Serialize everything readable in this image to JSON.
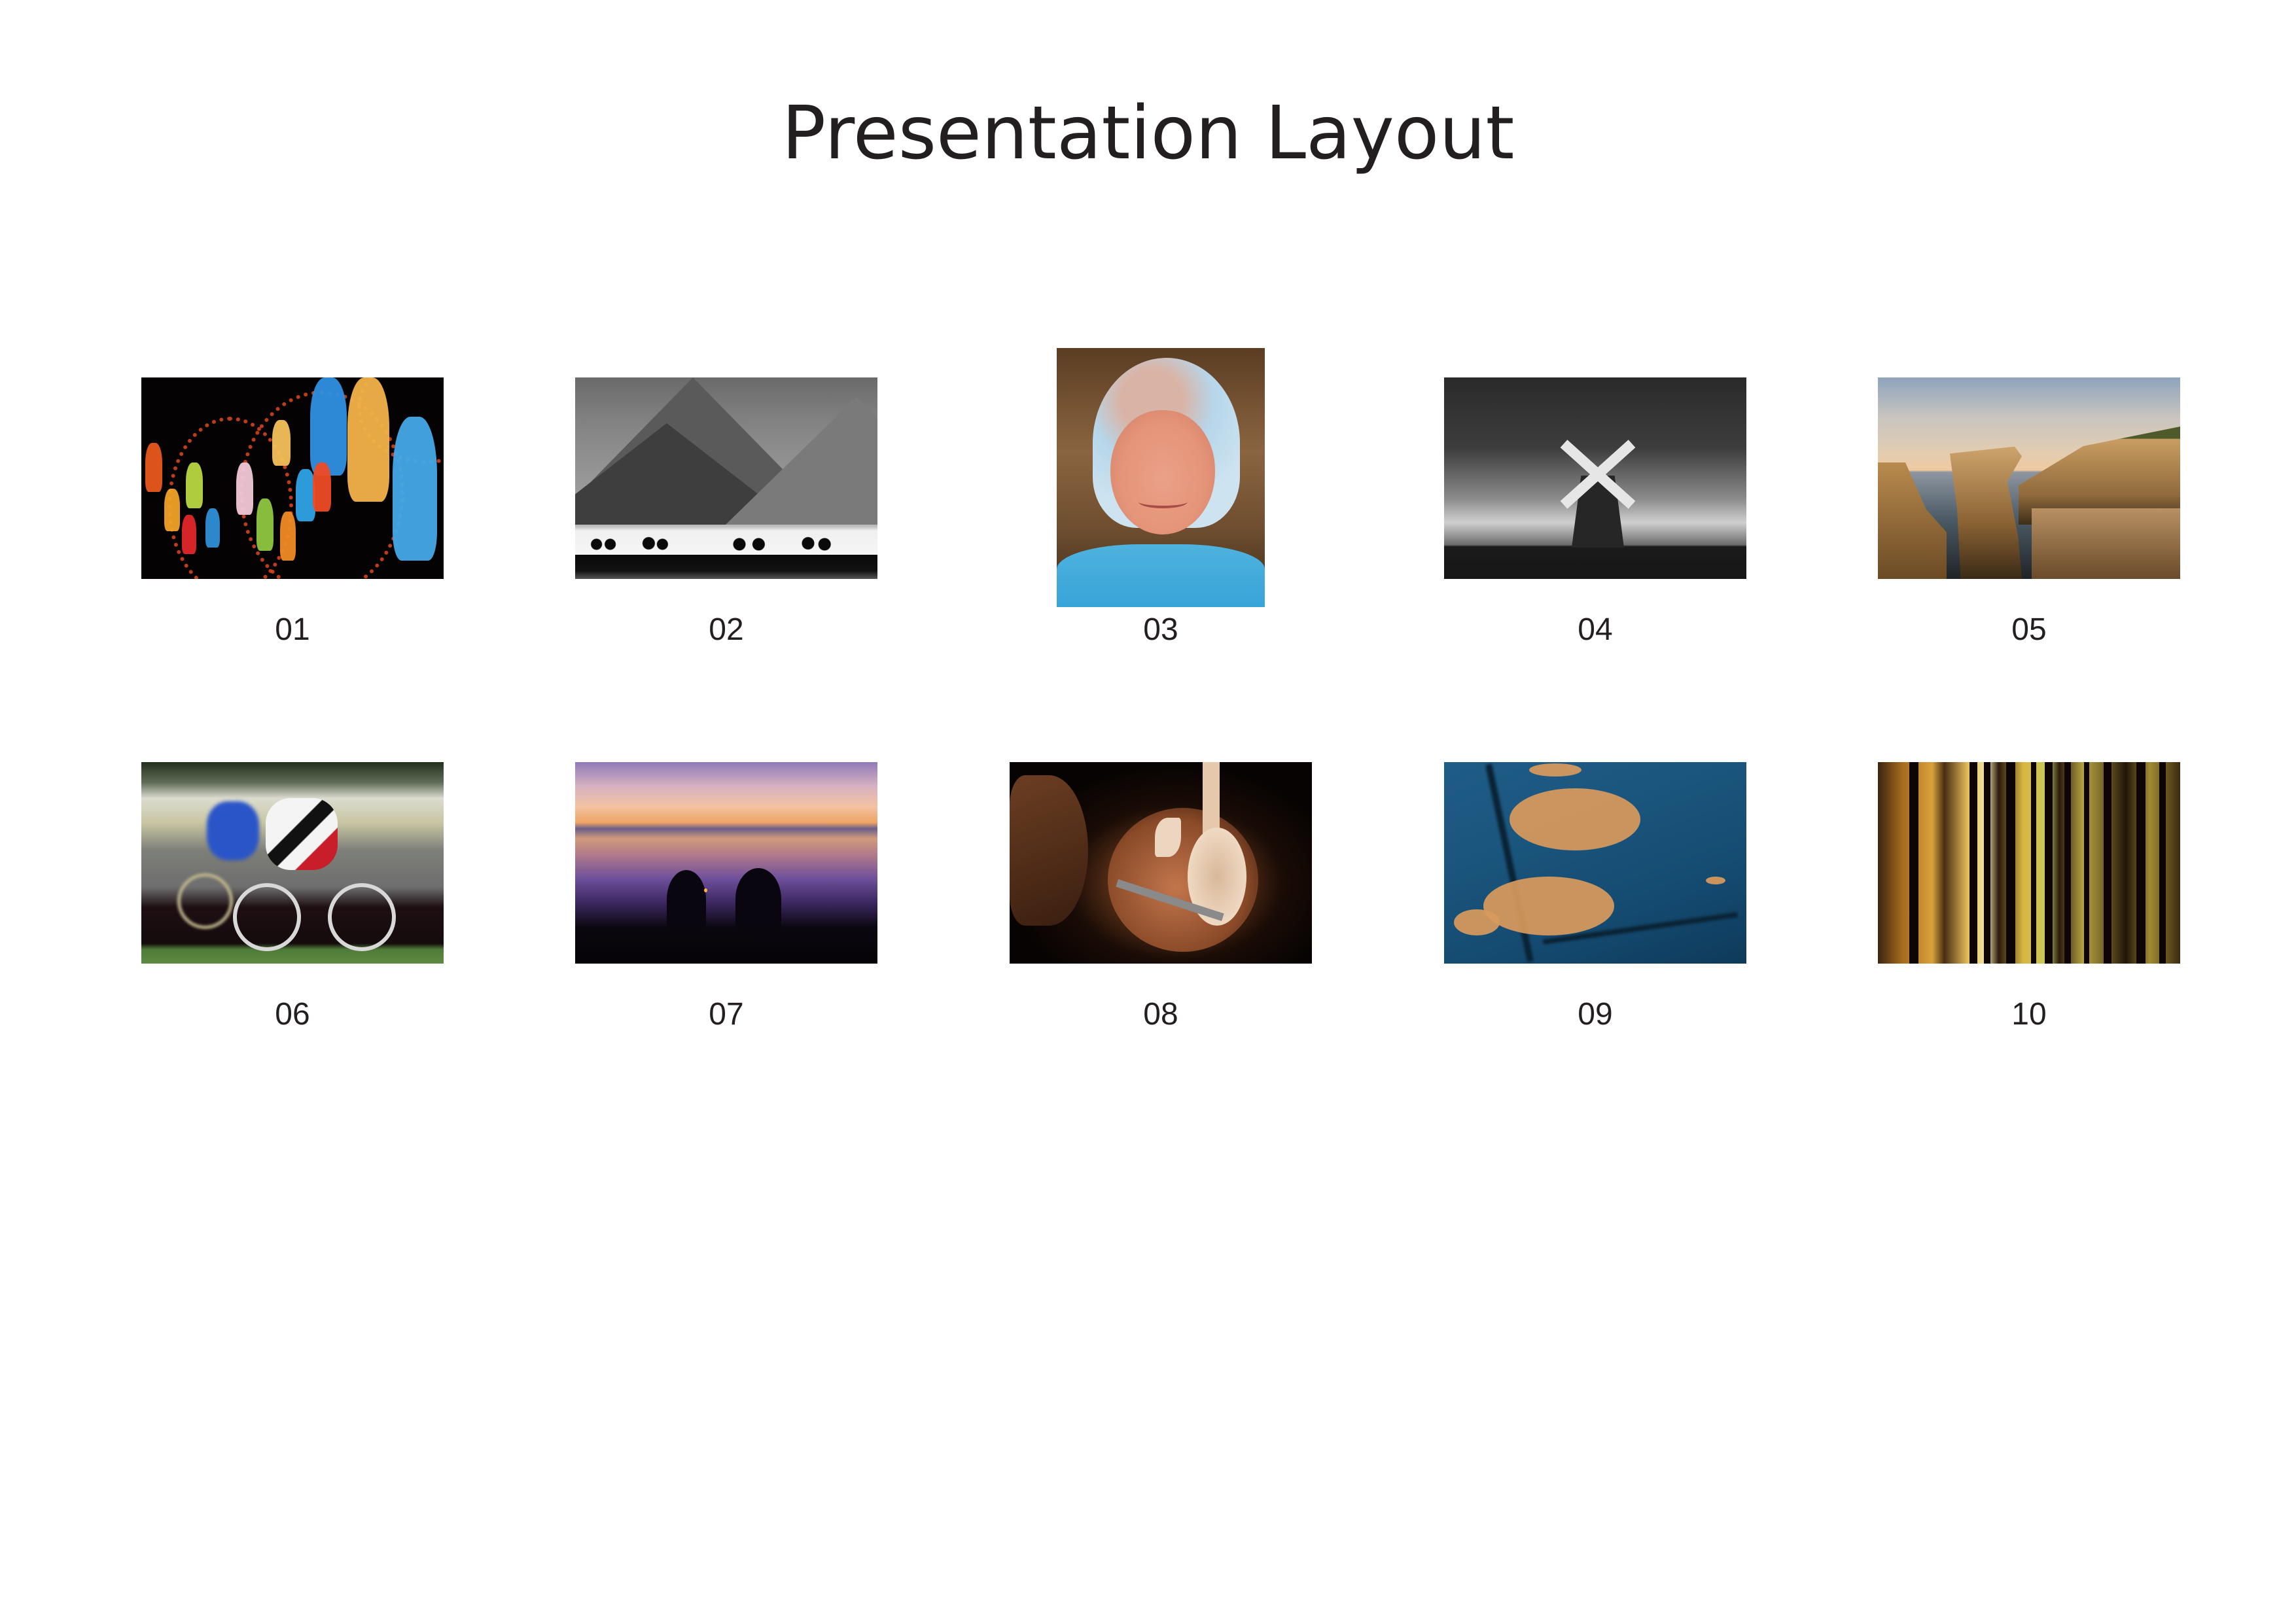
{
  "page": {
    "title": "Presentation Layout"
  },
  "gallery": {
    "rows": [
      {
        "items": [
          {
            "number": "01",
            "subject": "colorful hanging lanterns at night",
            "orientation": "landscape"
          },
          {
            "number": "02",
            "subject": "black-and-white mountains with silhouetted people by water",
            "orientation": "landscape"
          },
          {
            "number": "03",
            "subject": "smiling girl in floral headscarf",
            "orientation": "portrait"
          },
          {
            "number": "04",
            "subject": "black-and-white windmill under streaked sky",
            "orientation": "landscape"
          },
          {
            "number": "05",
            "subject": "layered sea cliffs at sunset",
            "orientation": "landscape"
          }
        ]
      },
      {
        "items": [
          {
            "number": "06",
            "subject": "cyclists racing with motion blur",
            "orientation": "landscape"
          },
          {
            "number": "07",
            "subject": "two silhouettes at lake during purple sunset",
            "orientation": "landscape"
          },
          {
            "number": "08",
            "subject": "hands carving a wooden spoon",
            "orientation": "landscape"
          },
          {
            "number": "09",
            "subject": "autumn leaves floating on blue water with branch reflection",
            "orientation": "landscape"
          },
          {
            "number": "10",
            "subject": "autumn forest with dark tree trunks",
            "orientation": "landscape"
          }
        ]
      }
    ]
  }
}
